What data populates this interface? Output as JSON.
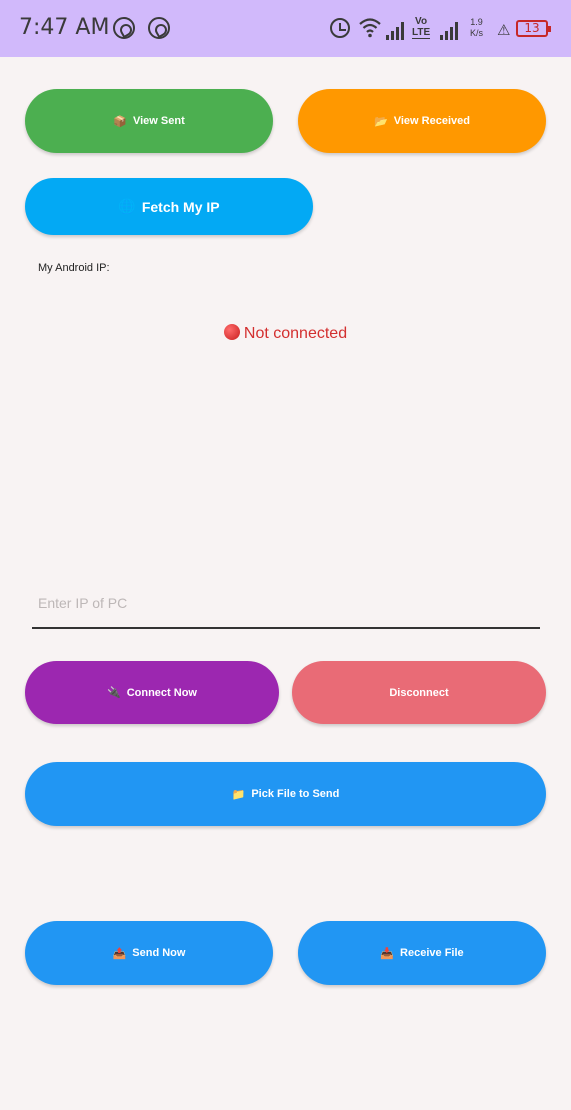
{
  "status_bar": {
    "time": "7:47 AM",
    "volte_top": "Vo",
    "volte_bottom": "LTE",
    "speed_value": "1.9",
    "speed_unit": "K/s",
    "battery": "13",
    "icons": [
      "whatsapp-icon",
      "whatsapp-icon",
      "alarm-icon",
      "wifi-icon",
      "signal-icon",
      "signal-icon",
      "flask-icon",
      "battery-icon"
    ]
  },
  "buttons": {
    "view_sent": {
      "emoji": "📦",
      "label": "View Sent",
      "color": "#4caf50"
    },
    "view_received": {
      "emoji": "📂",
      "label": "View Received",
      "color": "#ff9800"
    },
    "fetch_ip": {
      "emoji": "🌐",
      "label": "Fetch My IP",
      "color": "#03a9f4"
    },
    "connect_now": {
      "emoji": "🔌",
      "label": "Connect Now",
      "color": "#9c27b0"
    },
    "disconnect": {
      "label": "Disconnect",
      "color": "#e96b76"
    },
    "pick_file": {
      "emoji": "📁",
      "label": "Pick File to Send",
      "color": "#2196f3"
    },
    "send_now": {
      "emoji": "📤",
      "label": "Send Now",
      "color": "#2196f3"
    },
    "receive_file": {
      "emoji": "📥",
      "label": "Receive File",
      "color": "#2196f3"
    }
  },
  "ip_label": "My Android IP:",
  "connection_status": "Not connected",
  "ip_input": {
    "placeholder": "Enter IP of PC",
    "value": ""
  }
}
